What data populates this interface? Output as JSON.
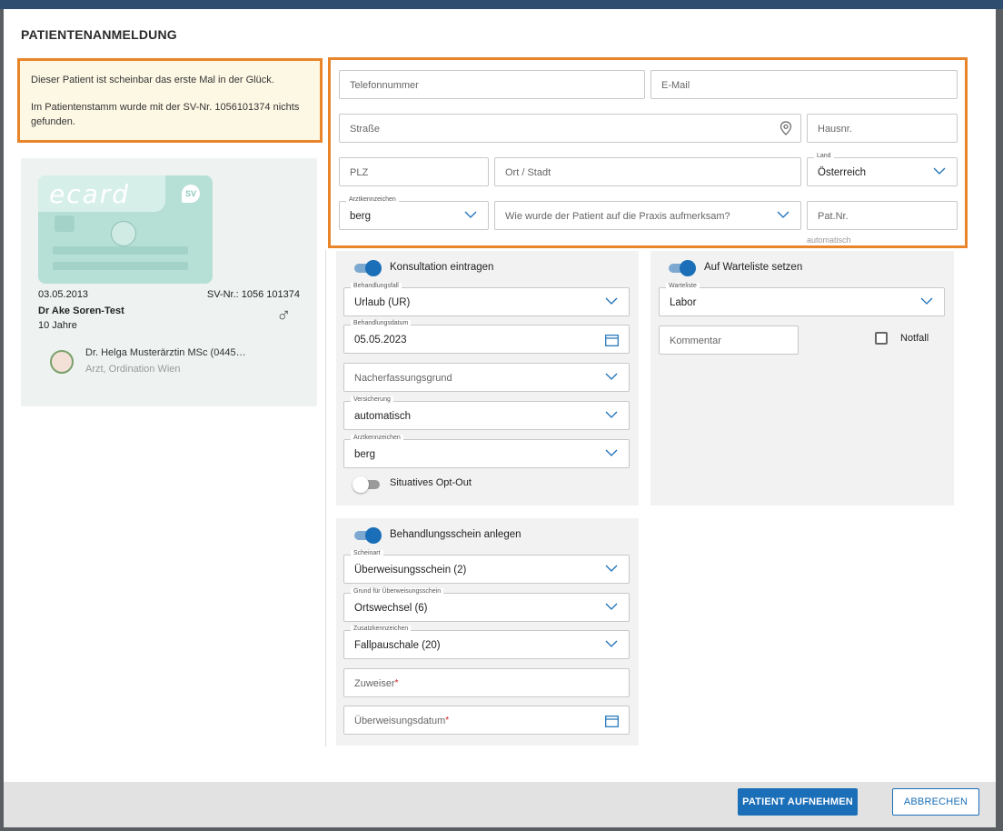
{
  "dialog": {
    "title": "PATIENTENANMELDUNG"
  },
  "notice": {
    "line1": "Dieser Patient ist scheinbar das erste Mal in der Glück.",
    "line2": "Im Patientenstamm wurde mit der SV-Nr. 1056101374 nichts gefunden."
  },
  "patient_card": {
    "card_logo": "ecard",
    "card_badge": "SV",
    "birthdate": "03.05.2013",
    "sv_number": "SV-Nr.: 1056 101374",
    "name": "Dr Ake Soren-Test",
    "age": "10 Jahre",
    "gender_symbol": "♂",
    "doctor_name": "Dr. Helga Musterärztin MSc (0445…",
    "doctor_subtitle": "Arzt, Ordination Wien"
  },
  "contact": {
    "phone_placeholder": "Telefonnummer",
    "email_placeholder": "E-Mail",
    "street_placeholder": "Straße",
    "house_placeholder": "Hausnr.",
    "zip_placeholder": "PLZ",
    "city_placeholder": "Ort / Stadt",
    "country_label": "Land",
    "country_value": "Österreich",
    "doctor_code_label": "Arztkennzeichen",
    "doctor_code_value": "berg",
    "referral_source_placeholder": "Wie wurde der Patient auf die Praxis aufmerksam?",
    "pat_nr_placeholder": "Pat.Nr.",
    "pat_nr_hint": "automatisch"
  },
  "consultation": {
    "toggle_label": "Konsultation eintragen",
    "toggle_on": true,
    "case_label": "Behandlungsfall",
    "case_value": "Urlaub (UR)",
    "date_label": "Behandlungsdatum",
    "date_value": "05.05.2023",
    "post_reason_placeholder": "Nacherfassungsgrund",
    "insurance_label": "Versicherung",
    "insurance_value": "automatisch",
    "doctor_code_label": "Arztkennzeichen",
    "doctor_code_value": "berg",
    "optout_label": "Situatives Opt-Out",
    "optout_on": false
  },
  "waitlist": {
    "toggle_label": "Auf Warteliste setzen",
    "toggle_on": true,
    "list_label": "Warteliste",
    "list_value": "Labor",
    "comment_placeholder": "Kommentar",
    "emergency_label": "Notfall",
    "emergency_checked": false
  },
  "treatment_slip": {
    "toggle_label": "Behandlungsschein anlegen",
    "toggle_on": true,
    "type_label": "Scheinart",
    "type_value": "Überweisungsschein (2)",
    "reason_label": "Grund für Überweisungsschein",
    "reason_value": "Ortswechsel (6)",
    "extra_label": "Zusatzkennzeichen",
    "extra_value": "Fallpauschale (20)",
    "referrer_placeholder": "Zuweiser",
    "referral_date_placeholder": "Überweisungsdatum",
    "required_mark": "*"
  },
  "footer": {
    "submit_label": "PATIENT AUFNEHMEN",
    "cancel_label": "ABBRECHEN"
  },
  "colors": {
    "accent": "#1a6fb8",
    "highlight_border": "#e8842a",
    "notice_bg": "#fdf8e4"
  }
}
